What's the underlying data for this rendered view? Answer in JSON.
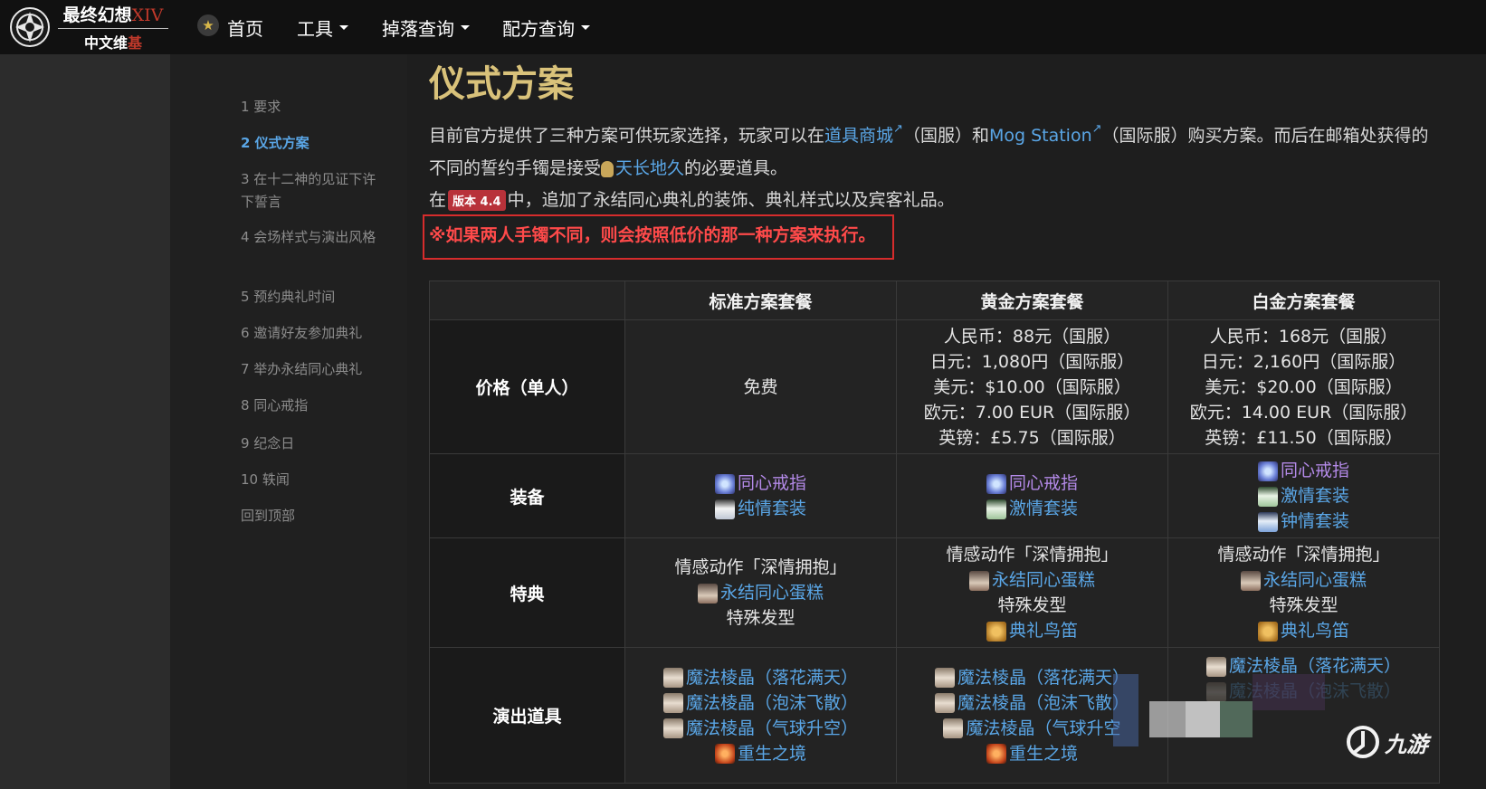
{
  "navbar": {
    "logo_title": "最终幻想",
    "logo_roman": "XIV",
    "logo_sub": "中文维",
    "logo_sub_red": "基",
    "menu": [
      {
        "label": "首页",
        "has_caret": false
      },
      {
        "label": "工具",
        "has_caret": true
      },
      {
        "label": "掉落查询",
        "has_caret": true
      },
      {
        "label": "配方查询",
        "has_caret": true
      }
    ]
  },
  "toc": {
    "items": [
      {
        "label": "1 要求",
        "active": false
      },
      {
        "label": "2 仪式方案",
        "active": true
      },
      {
        "label": "3 在十二神的见证下许下誓言",
        "active": false
      },
      {
        "label": "4 会场样式与演出风格",
        "active": false
      },
      {
        "label": "5 预约典礼时间",
        "active": false
      },
      {
        "label": "6 邀请好友参加典礼",
        "active": false
      },
      {
        "label": "7 举办永结同心典礼",
        "active": false
      },
      {
        "label": "8 同心戒指",
        "active": false
      },
      {
        "label": "9 纪念日",
        "active": false
      },
      {
        "label": "10 轶闻",
        "active": false
      },
      {
        "label": "回到顶部",
        "active": false
      }
    ]
  },
  "content": {
    "title": "仪式方案",
    "p1_a": "目前官方提供了三种方案可供玩家选择，玩家可以在",
    "p1_link1": "道具商城",
    "p1_b": "（国服）和",
    "p1_link2": "Mog Station",
    "p1_c": "（国际服）购买方案。而后在邮箱处获得的",
    "p2_a": "不同的誓约手镯是接受",
    "p2_link": "天长地久",
    "p2_b": "的必要道具。",
    "p3_a": "在",
    "p3_badge": "版本 4.4",
    "p3_b": "中，追加了永结同心典礼的装饰、典礼样式以及宾客礼品。",
    "notice": "※如果两人手镯不同，则会按照低价的那一种方案来执行。"
  },
  "table": {
    "headers": [
      "",
      "标准方案套餐",
      "黄金方案套餐",
      "白金方案套餐"
    ],
    "rows": {
      "price": {
        "label": "价格（单人）",
        "standard": [
          "免费"
        ],
        "gold": [
          "人民币：88元（国服）",
          "日元：1,080円（国际服）",
          "美元：$10.00（国际服）",
          "欧元：7.00 EUR（国际服）",
          "英镑：£5.75（国际服）"
        ],
        "platinum": [
          "人民币：168元（国服）",
          "日元：2,160円（国际服）",
          "美元：$20.00（国际服）",
          "欧元：14.00 EUR（国际服）",
          "英镑：£11.50（国际服）"
        ]
      },
      "equipment": {
        "label": "装备",
        "standard": [
          {
            "icon": "ring-icon",
            "text": "同心戒指",
            "color": "purple"
          },
          {
            "icon": "dress-icon",
            "text": "纯情套装",
            "color": "blue"
          }
        ],
        "gold": [
          {
            "icon": "ring-icon",
            "text": "同心戒指",
            "color": "purple"
          },
          {
            "icon": "dress-icon",
            "text": "激情套装",
            "color": "blue"
          }
        ],
        "platinum": [
          {
            "icon": "ring-icon",
            "text": "同心戒指",
            "color": "purple"
          },
          {
            "icon": "dress-icon",
            "text": "激情套装",
            "color": "blue"
          },
          {
            "icon": "dress-icon",
            "text": "钟情套装",
            "color": "blue"
          }
        ]
      },
      "perks": {
        "label": "特典",
        "standard": [
          {
            "text": "情感动作「深情拥抱」"
          },
          {
            "icon": "cake-icon",
            "text": "永结同心蛋糕"
          },
          {
            "text": "特殊发型"
          }
        ],
        "gold": [
          {
            "text": "情感动作「深情拥抱」"
          },
          {
            "icon": "cake-icon",
            "text": "永结同心蛋糕"
          },
          {
            "text": "特殊发型"
          },
          {
            "icon": "bird-whistle-icon",
            "text": "典礼鸟笛"
          }
        ],
        "platinum": [
          {
            "text": "情感动作「深情拥抱」"
          },
          {
            "icon": "cake-icon",
            "text": "永结同心蛋糕"
          },
          {
            "text": "特殊发型"
          },
          {
            "icon": "bird-whistle-icon",
            "text": "典礼鸟笛"
          }
        ]
      },
      "performance": {
        "label": "演出道具",
        "standard": [
          "魔法棱晶（落花满天）",
          "魔法棱晶（泡沫飞散）",
          "魔法棱晶（气球升空）",
          "重生之境"
        ],
        "gold": [
          "魔法棱晶（落花满天）",
          "魔法棱晶（泡沫飞散）",
          "魔法棱晶（气球升空",
          "重生之境"
        ],
        "platinum": [
          "魔法棱晶（落花满天）",
          "魔法棱晶（泡沫飞散）"
        ]
      }
    }
  },
  "watermark": {
    "text": "九游"
  },
  "colors": {
    "link": "#5aa6e6",
    "title": "#d9c27a",
    "notice": "#ff4a4a",
    "badge": "#b8323a"
  }
}
